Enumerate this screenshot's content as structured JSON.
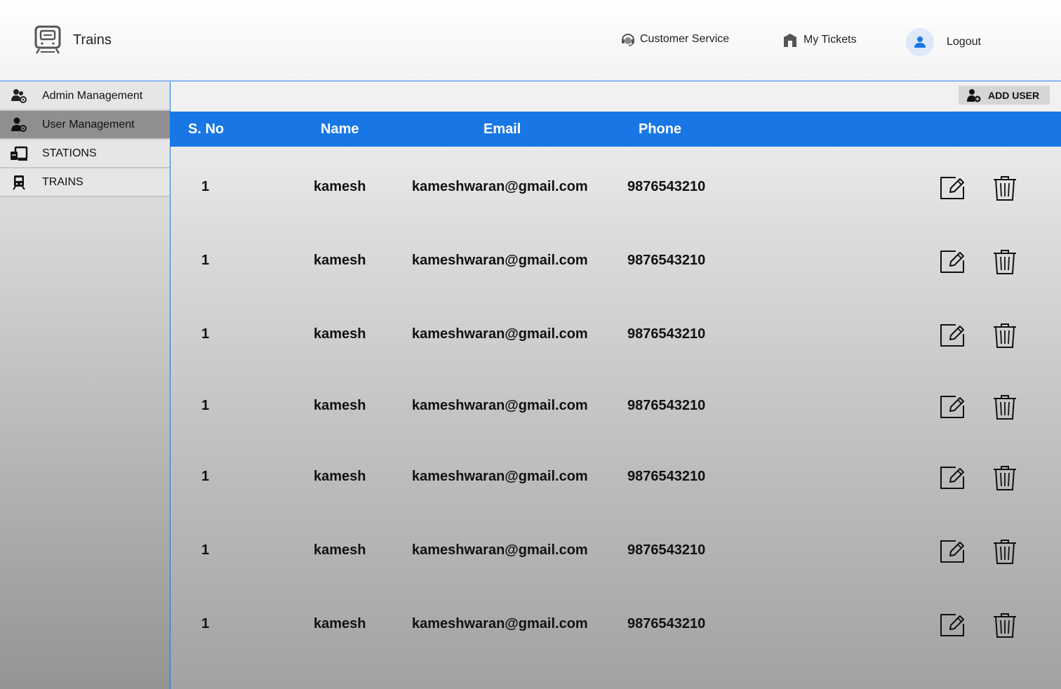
{
  "app": {
    "title": "Trains"
  },
  "header": {
    "customer_service": "Customer Service",
    "my_tickets": "My Tickets",
    "logout": "Logout"
  },
  "sidebar": {
    "items": [
      {
        "label": "Admin Management",
        "icon": "users-gear-icon",
        "active": false
      },
      {
        "label": "User Management",
        "icon": "user-gear-icon",
        "active": true
      },
      {
        "label": "STATIONS",
        "icon": "station-icon",
        "active": false
      },
      {
        "label": "TRAINS",
        "icon": "train-icon",
        "active": false
      }
    ]
  },
  "toolbar": {
    "add_user_label": "ADD USER"
  },
  "table": {
    "columns": [
      "S. No",
      "Name",
      "Email",
      "Phone"
    ],
    "rows": [
      {
        "sno": "1",
        "name": "kamesh",
        "email": "kameshwaran@gmail.com",
        "phone": "9876543210"
      },
      {
        "sno": "1",
        "name": "kamesh",
        "email": "kameshwaran@gmail.com",
        "phone": "9876543210"
      },
      {
        "sno": "1",
        "name": "kamesh",
        "email": "kameshwaran@gmail.com",
        "phone": "9876543210"
      },
      {
        "sno": "1",
        "name": "kamesh",
        "email": "kameshwaran@gmail.com",
        "phone": "9876543210"
      },
      {
        "sno": "1",
        "name": "kamesh",
        "email": "kameshwaran@gmail.com",
        "phone": "9876543210"
      },
      {
        "sno": "1",
        "name": "kamesh",
        "email": "kameshwaran@gmail.com",
        "phone": "9876543210"
      },
      {
        "sno": "1",
        "name": "kamesh",
        "email": "kameshwaran@gmail.com",
        "phone": "9876543210"
      }
    ],
    "row_actions": [
      "edit-icon",
      "trash-icon"
    ]
  },
  "colors": {
    "accent": "#1877e5",
    "active_sidebar": "#8f8f8f",
    "avatar_bg": "#dde9f8"
  }
}
